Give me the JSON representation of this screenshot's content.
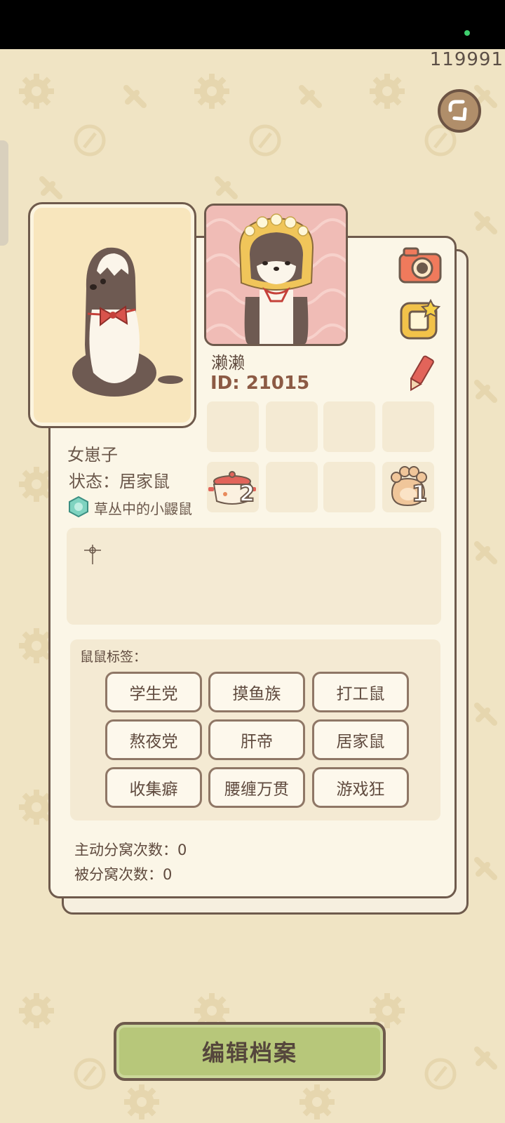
{
  "top_counter": "119991",
  "profile": {
    "nickname": "濑濑",
    "id_text": "ID: 21015",
    "gender": "女崽子",
    "status": "状态：居家鼠",
    "badge": "草丛中的小鼹鼠"
  },
  "inventory": {
    "pot_count": "2",
    "paw_count": "1"
  },
  "tags": {
    "title": "鼠鼠标签：",
    "items": [
      "学生党",
      "摸鱼族",
      "打工鼠",
      "熬夜党",
      "肝帝",
      "居家鼠",
      "收集癖",
      "腰缠万贯",
      "游戏狂"
    ]
  },
  "stats": {
    "active_split": "主动分窝次数：0",
    "passive_split": "被分窝次数：0"
  },
  "edit_button": "编辑档案",
  "icons": [
    "back-icon",
    "camera-icon",
    "share-star-icon",
    "pencil-icon",
    "pot-icon",
    "paw-icon",
    "badge-icon"
  ],
  "colors": {
    "background": "#f0e4c4",
    "card": "#fbf6e7",
    "border": "#6e5a4c",
    "edit_button": "#b7c77a"
  }
}
